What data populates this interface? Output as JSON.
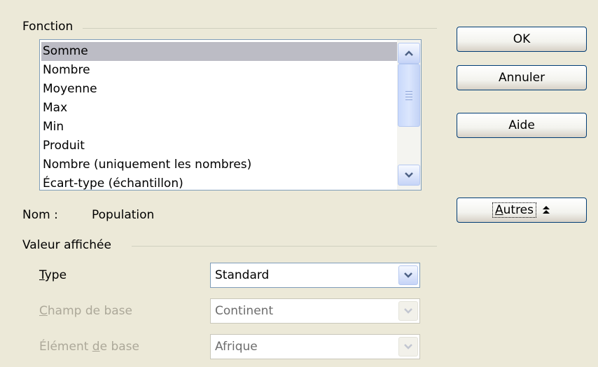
{
  "fonction": {
    "group_label": "Fonction",
    "items": [
      {
        "label": "Somme",
        "selected": true
      },
      {
        "label": "Nombre",
        "selected": false
      },
      {
        "label": "Moyenne",
        "selected": false
      },
      {
        "label": "Max",
        "selected": false
      },
      {
        "label": "Min",
        "selected": false
      },
      {
        "label": "Produit",
        "selected": false
      },
      {
        "label": "Nombre (uniquement les nombres)",
        "selected": false
      },
      {
        "label": "Écart-type (échantillon)",
        "selected": false
      }
    ]
  },
  "nom": {
    "label": "Nom :",
    "value": "Population"
  },
  "valeur_affichee": {
    "group_label": "Valeur affichée",
    "type": {
      "label_pre": "",
      "label_mnemonic": "T",
      "label_post": "ype",
      "value": "Standard"
    },
    "champ_de_base": {
      "label_pre": "",
      "label_mnemonic": "C",
      "label_post": "hamp de base",
      "value": "Continent"
    },
    "element_de_base": {
      "label_pre": "Élément ",
      "label_mnemonic": "d",
      "label_post": "e base",
      "value": "Afrique"
    }
  },
  "buttons": {
    "ok": "OK",
    "cancel": "Annuler",
    "help": "Aide",
    "more_mnemonic": "A",
    "more_rest": "utres"
  },
  "icons": {
    "scroll_up": "arrow-up-icon",
    "scroll_down": "arrow-down-icon",
    "combo_arrow": "chevron-down-icon",
    "more_arrow": "double-chevron-up-icon"
  }
}
